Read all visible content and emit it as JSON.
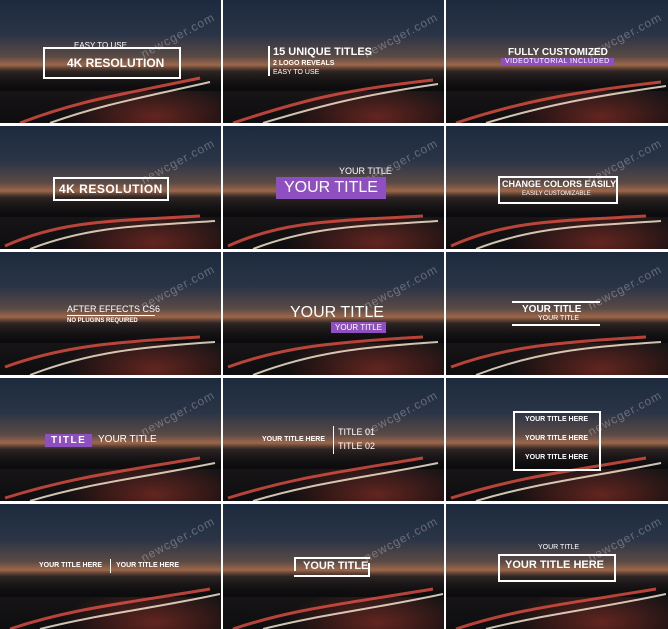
{
  "watermark": "newcger.com",
  "accent_color": "#8e4fc0",
  "tiles": [
    {
      "top": "EASY TO USE",
      "main": "4K RESOLUTION"
    },
    {
      "main": "15 UNIQUE TITLES",
      "sub1": "2 LOGO REVEALS",
      "sub2": "EASY TO USE"
    },
    {
      "main": "FULLY CUSTOMIZED",
      "sub": "VIDEOTUTORIAL INCLUDED"
    },
    {
      "main": "4K RESOLUTION"
    },
    {
      "top": "YOUR TITLE",
      "main": "YOUR TITLE"
    },
    {
      "main": "CHANGE COLORS EASILY",
      "sub": "EASILY CUSTOMIZABLE"
    },
    {
      "main": "AFTER EFFECTS CS6",
      "sub": "NO PLUGINS REQUIRED"
    },
    {
      "main": "YOUR TITLE",
      "sub": "YOUR TITLE"
    },
    {
      "main": "YOUR TITLE",
      "sub": "YOUR TITLE"
    },
    {
      "tag": "TITLE",
      "main": "YOUR TITLE"
    },
    {
      "main": "YOUR TITLE HERE",
      "r1": "TITLE 01",
      "r2": "TITLE 02"
    },
    {
      "l1": "YOUR TITLE HERE",
      "l2": "YOUR TITLE HERE",
      "l3": "YOUR TITLE HERE"
    },
    {
      "left": "YOUR TITLE HERE",
      "right": "YOUR TITLE HERE"
    },
    {
      "main": "YOUR TITLE"
    },
    {
      "top": "YOUR TITLE",
      "main": "YOUR TITLE HERE"
    }
  ]
}
